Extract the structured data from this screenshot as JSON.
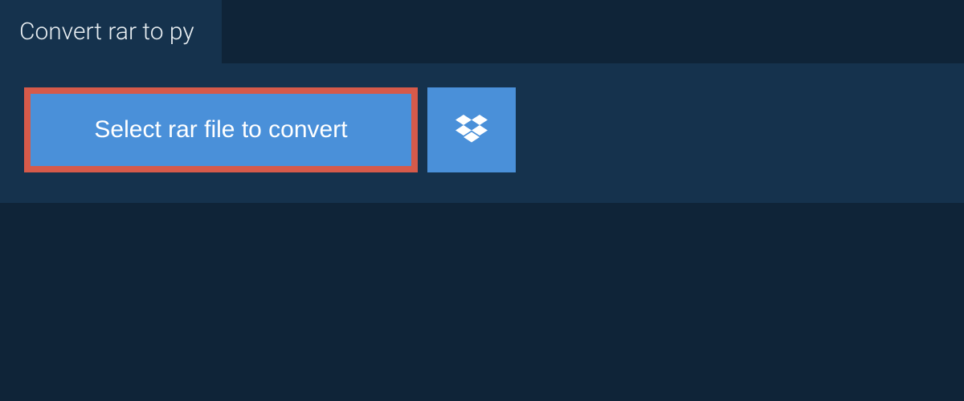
{
  "tab": {
    "title": "Convert rar to py"
  },
  "actions": {
    "select_file_label": "Select rar file to convert"
  },
  "colors": {
    "background_dark": "#0f2438",
    "panel": "#15324d",
    "button_primary": "#4a90d9",
    "highlight_border": "#d65a4a",
    "text": "#ffffff"
  },
  "icons": {
    "dropbox": "dropbox-icon"
  }
}
